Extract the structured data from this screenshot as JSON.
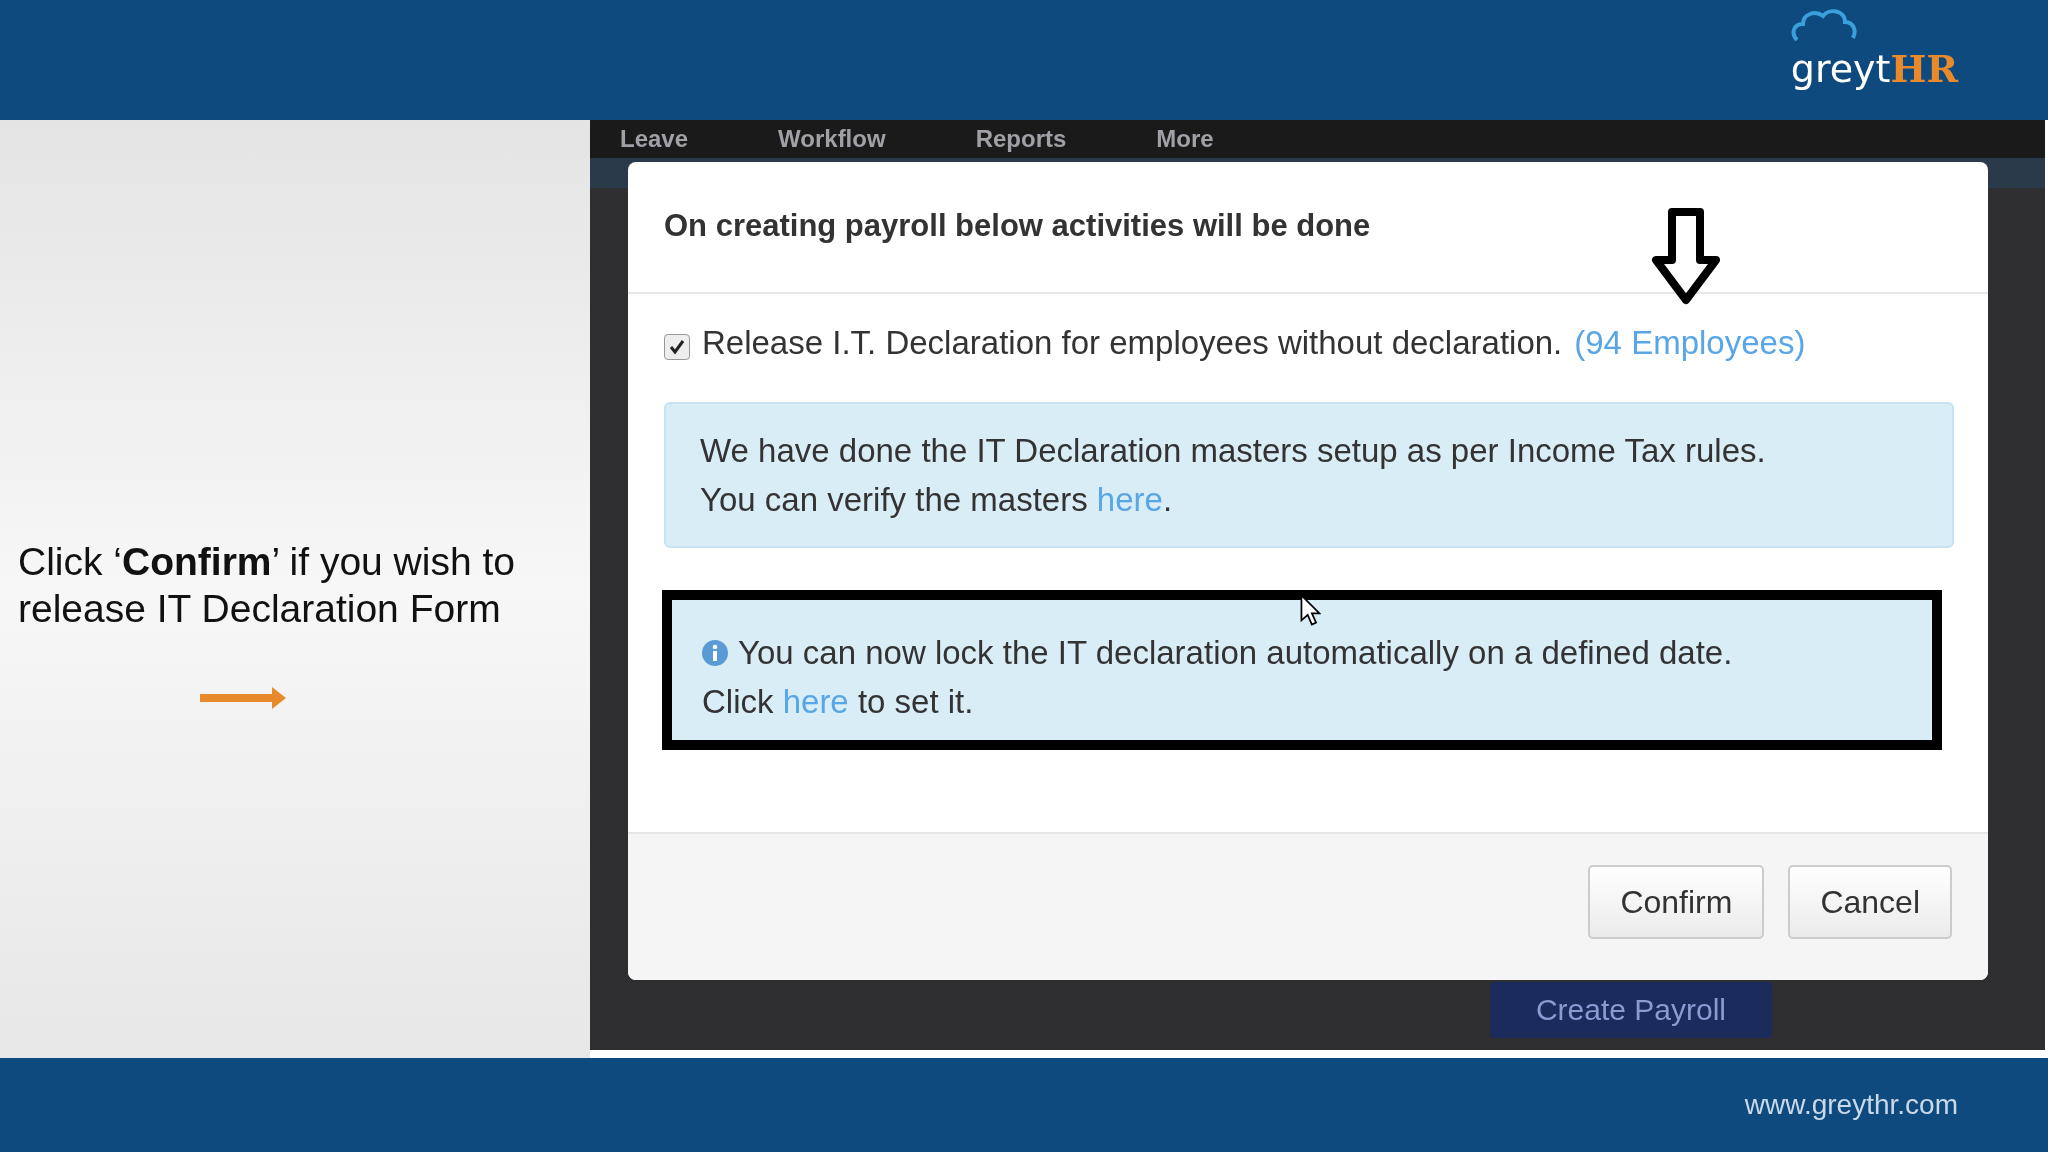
{
  "header": {
    "logo": {
      "brand": "greyt",
      "brand_accent": "HR"
    }
  },
  "slide_note": {
    "before": "Click ‘",
    "bold": "Confirm",
    "after": "’ if you wish to release IT Declaration Form"
  },
  "background_app": {
    "nav": [
      "Leave",
      "Workflow",
      "Reports",
      "More"
    ],
    "button": "Create Payroll"
  },
  "dialog": {
    "title": "On creating payroll below activities will be done",
    "option": {
      "checked": true,
      "label": "Release I.T. Declaration for employees without declaration.",
      "link": "(94 Employees)"
    },
    "info": {
      "line1": "We have done the IT Declaration masters setup as per Income Tax rules.",
      "line2": "You can verify the masters ",
      "link": "here",
      "end": "."
    },
    "highlight": {
      "line1": "You can now lock the IT declaration automatically on a defined date.",
      "line2_before": "Click ",
      "link": "here",
      "line2_after": " to set it."
    },
    "buttons": [
      "Confirm",
      "Cancel"
    ]
  },
  "footer": {
    "url": "www.greythr.com"
  }
}
